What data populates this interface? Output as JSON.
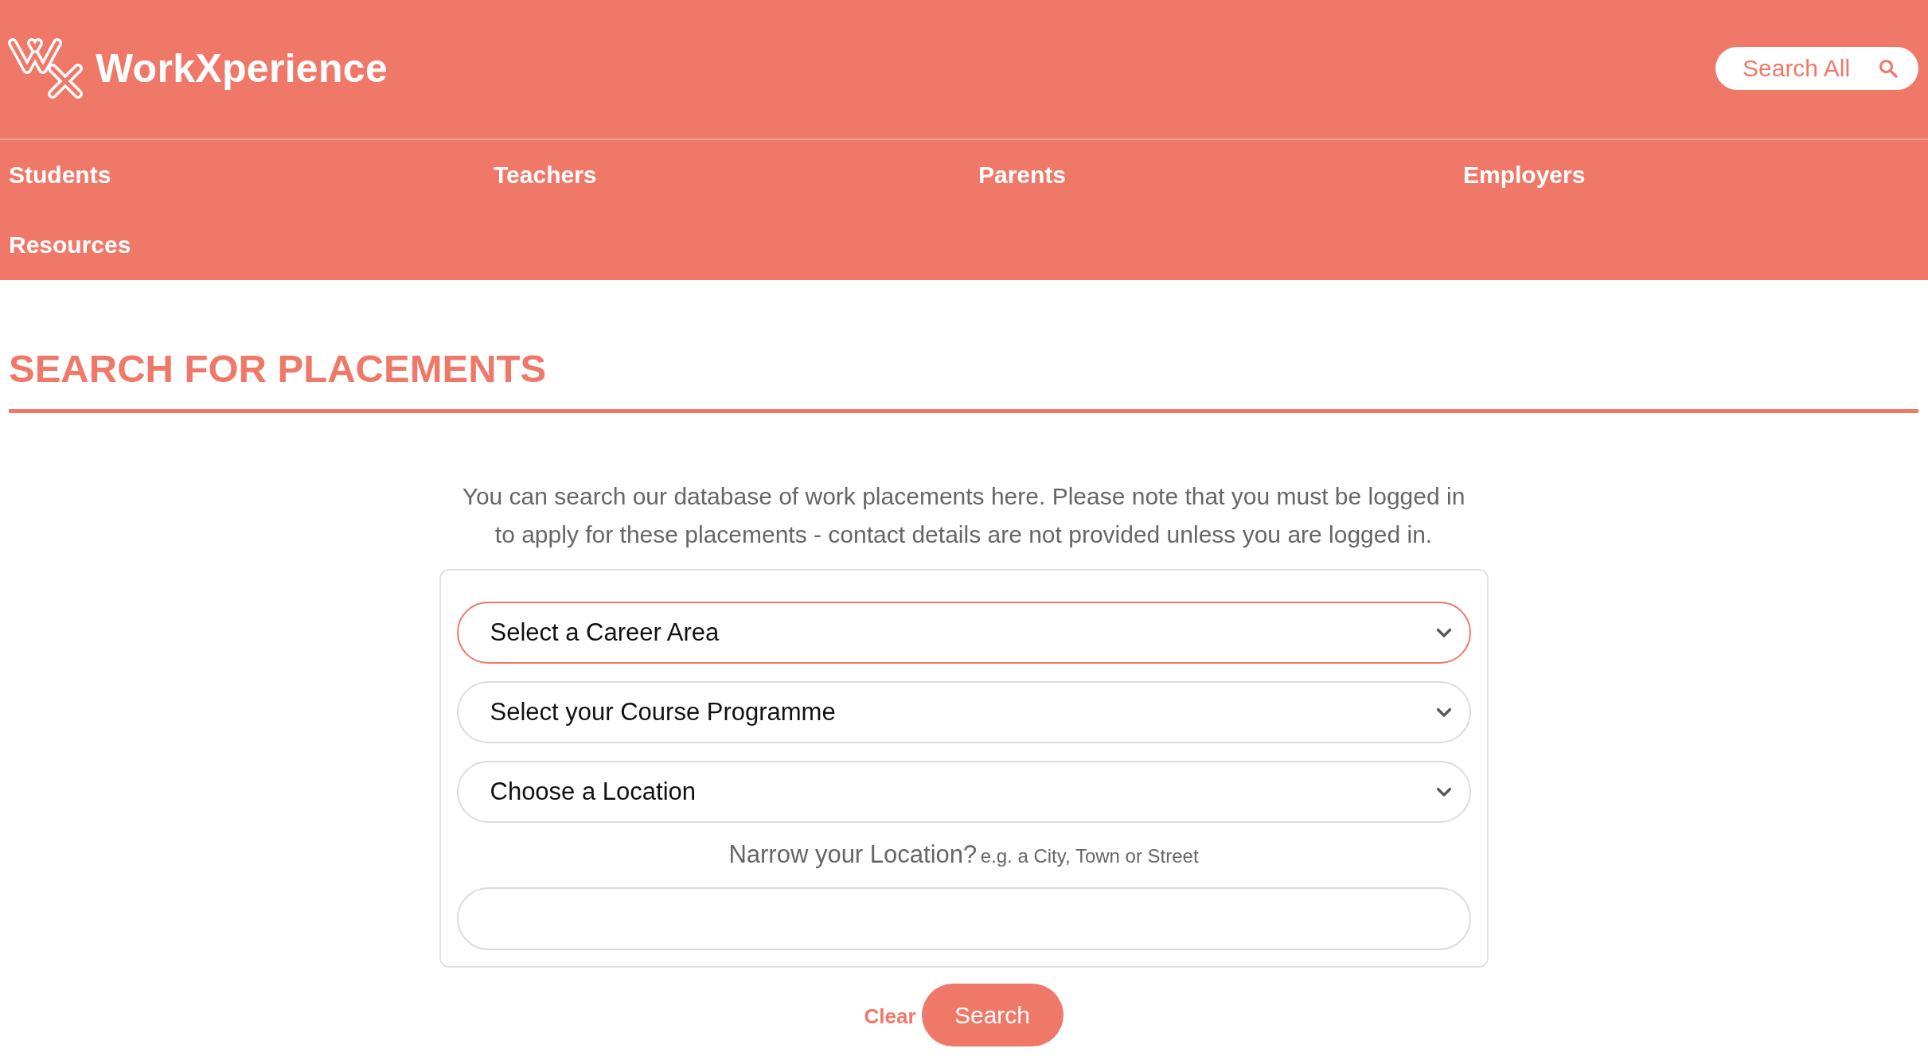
{
  "header": {
    "brand": {
      "name": "WorkXperience"
    },
    "search_all": {
      "label": "Search All"
    },
    "nav": {
      "items": [
        {
          "label": "Students"
        },
        {
          "label": "Teachers"
        },
        {
          "label": "Parents"
        },
        {
          "label": "Employers"
        },
        {
          "label": "Resources"
        }
      ]
    }
  },
  "page": {
    "title": "SEARCH FOR PLACEMENTS",
    "intro": "You can search our database of work placements here. Please note that you must be logged in to apply for these placements - contact details are not provided unless you are logged in."
  },
  "search_form": {
    "selects": [
      {
        "value": "Select a Career Area",
        "focused": true
      },
      {
        "value": "Select your Course Programme",
        "focused": false
      },
      {
        "value": "Choose a Location",
        "focused": false
      }
    ],
    "narrow_location": {
      "label": "Narrow your Location?",
      "hint": "e.g. a City, Town or Street"
    },
    "buttons": [
      {
        "kind": "link",
        "label": "Clear"
      },
      {
        "kind": "primary",
        "label": "Search"
      }
    ]
  }
}
